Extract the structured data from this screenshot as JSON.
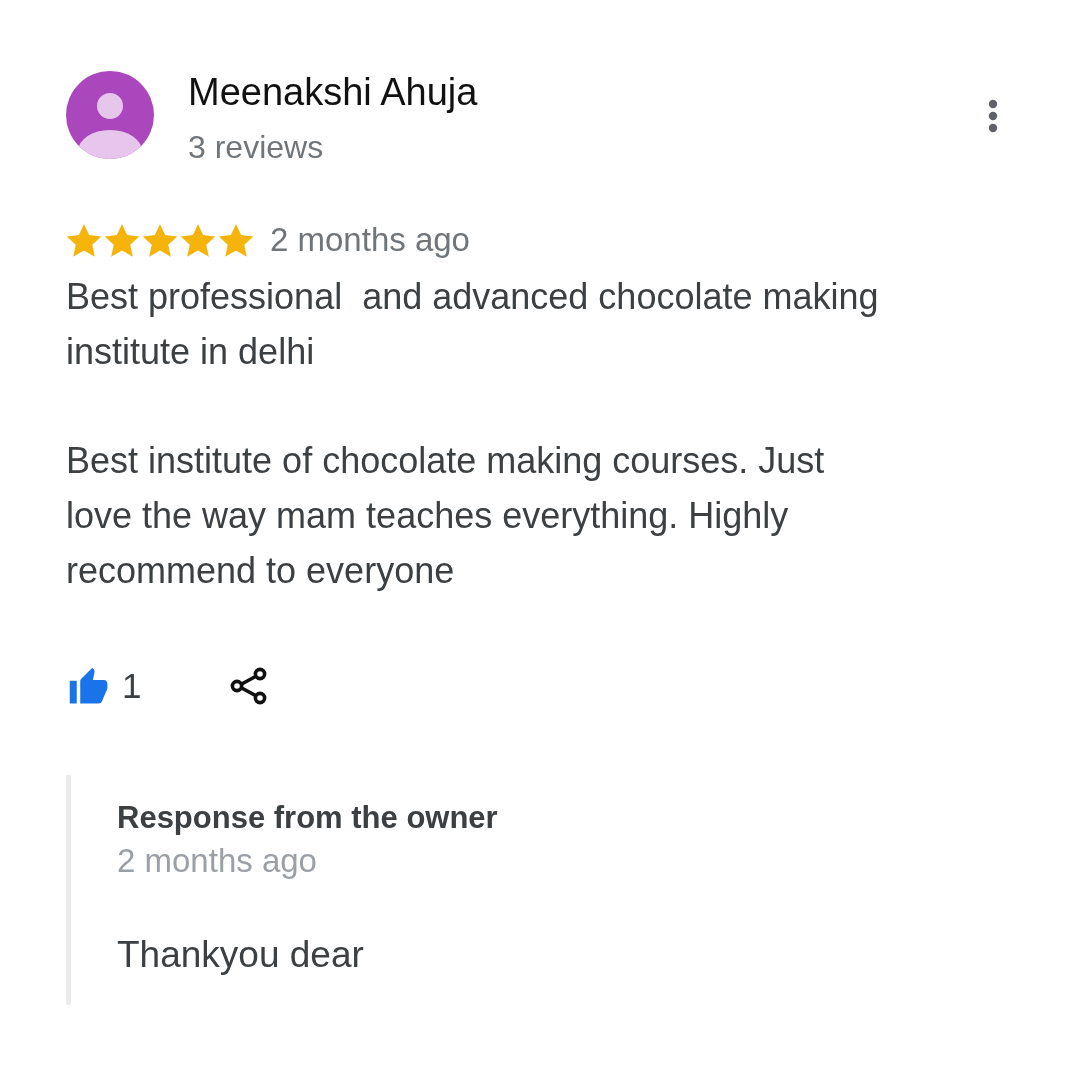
{
  "review": {
    "author": {
      "name": "Meenakshi Ahuja",
      "reviews": "3 reviews"
    },
    "stars": 5,
    "time": "2 months ago",
    "text": "Best professional  and advanced chocolate making\ninstitute in delhi\n\nBest institute of chocolate making courses. Just\nlove the way mam teaches everything. Highly\nrecommend to everyone",
    "likes": {
      "count": "1",
      "liked": true
    }
  },
  "owner_response": {
    "title": "Response from the owner",
    "time": "2 months ago",
    "text": "Thankyou dear"
  }
}
